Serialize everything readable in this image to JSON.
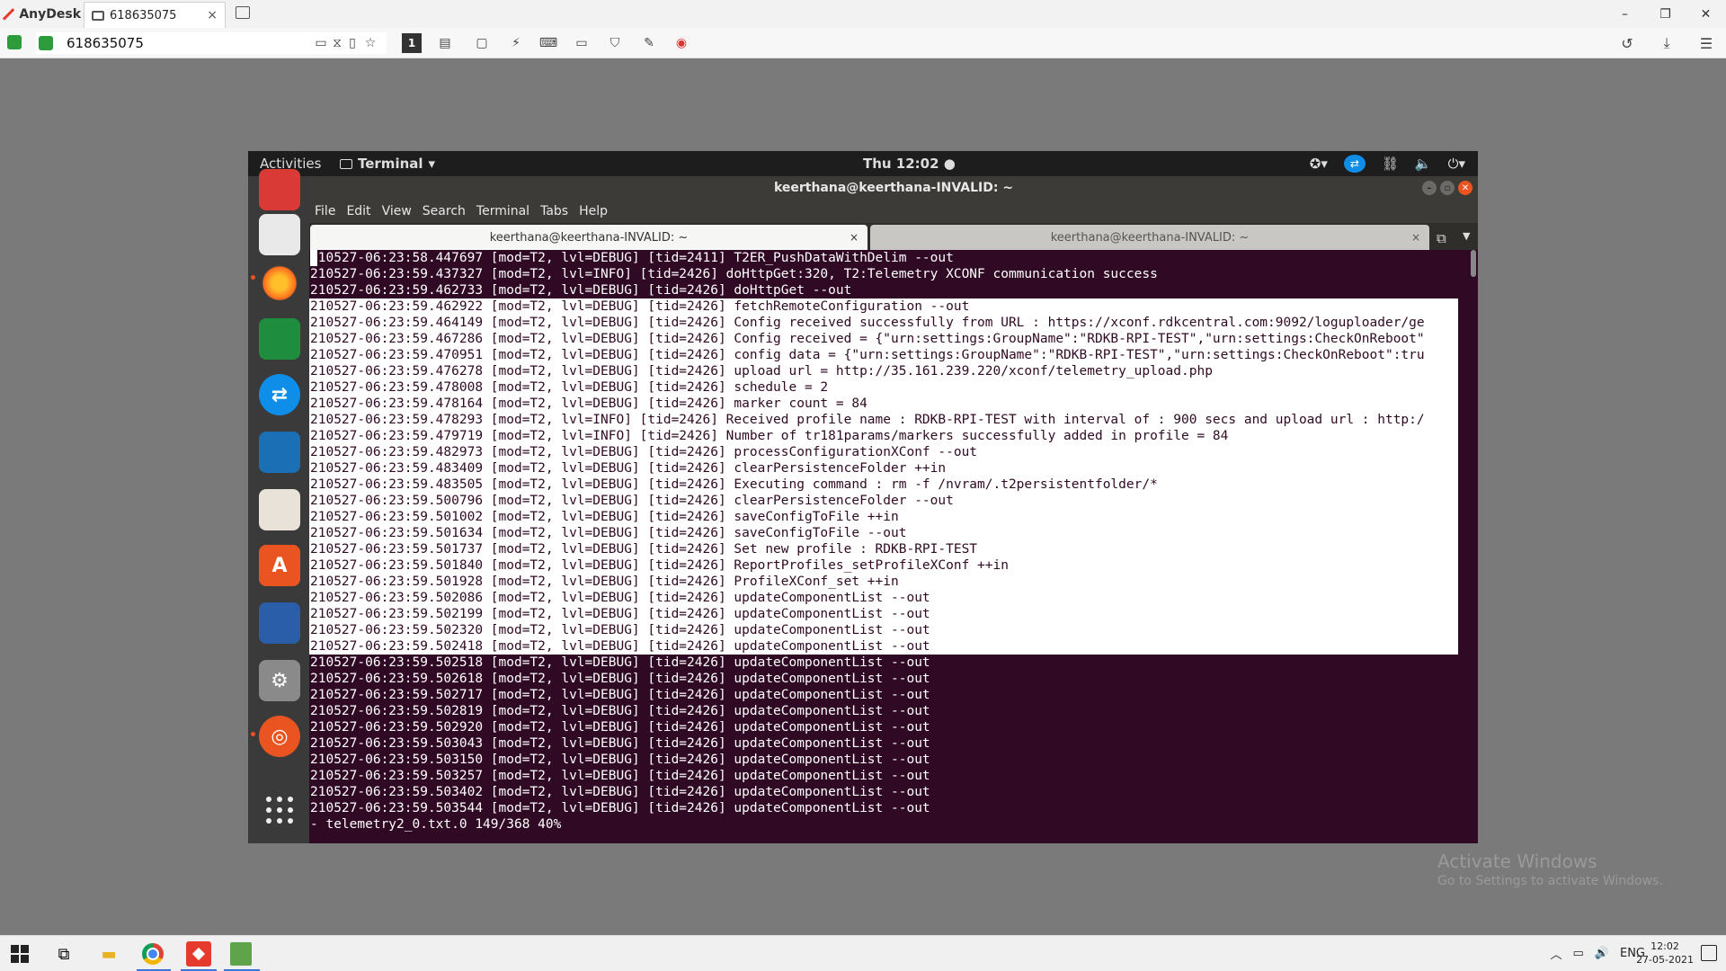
{
  "anydesk": {
    "app_name": "AnyDesk",
    "tab_label": "618635075",
    "tab_close": "×",
    "address_value": "618635075",
    "toolbar_number": "1",
    "win_min": "–",
    "win_restore": "❐",
    "win_close": "✕"
  },
  "ubuntu": {
    "activities": "Activities",
    "app_menu": "Terminal",
    "clock": "Thu 12:02 ●",
    "tv_badge": "⇄"
  },
  "terminal": {
    "window_title": "keerthana@keerthana-INVALID: ~",
    "menu": [
      "File",
      "Edit",
      "View",
      "Search",
      "Terminal",
      "Tabs",
      "Help"
    ],
    "tabs": [
      {
        "label": "keerthana@keerthana-INVALID: ~",
        "close": "×"
      },
      {
        "label": "keerthana@keerthana-INVALID: ~",
        "close": "×"
      }
    ],
    "lines": [
      "210527-06:23:58.447697 [mod=T2, lvl=DEBUG] [tid=2411] T2ER_PushDataWithDelim --out",
      "210527-06:23:59.437327 [mod=T2, lvl=INFO] [tid=2426] doHttpGet:320, T2:Telemetry XCONF communication success",
      "210527-06:23:59.462733 [mod=T2, lvl=DEBUG] [tid=2426] doHttpGet --out",
      "210527-06:23:59.462922 [mod=T2, lvl=DEBUG] [tid=2426] fetchRemoteConfiguration --out",
      "210527-06:23:59.464149 [mod=T2, lvl=DEBUG] [tid=2426] Config received successfully from URL : https://xconf.rdkcentral.com:9092/loguploader/ge",
      "210527-06:23:59.467286 [mod=T2, lvl=DEBUG] [tid=2426] Config received = {\"urn:settings:GroupName\":\"RDKB-RPI-TEST\",\"urn:settings:CheckOnReboot\"",
      "210527-06:23:59.470951 [mod=T2, lvl=DEBUG] [tid=2426] config data = {\"urn:settings:GroupName\":\"RDKB-RPI-TEST\",\"urn:settings:CheckOnReboot\":tru",
      "210527-06:23:59.476278 [mod=T2, lvl=DEBUG] [tid=2426] upload url = http://35.161.239.220/xconf/telemetry_upload.php",
      "210527-06:23:59.478008 [mod=T2, lvl=DEBUG] [tid=2426] schedule = 2",
      "210527-06:23:59.478164 [mod=T2, lvl=DEBUG] [tid=2426] marker count = 84",
      "210527-06:23:59.478293 [mod=T2, lvl=INFO] [tid=2426] Received profile name : RDKB-RPI-TEST with interval of : 900 secs and upload url : http:/",
      "210527-06:23:59.479719 [mod=T2, lvl=INFO] [tid=2426] Number of tr181params/markers successfully added in profile = 84",
      "210527-06:23:59.482973 [mod=T2, lvl=DEBUG] [tid=2426] processConfigurationXConf --out",
      "210527-06:23:59.483409 [mod=T2, lvl=DEBUG] [tid=2426] clearPersistenceFolder ++in",
      "210527-06:23:59.483505 [mod=T2, lvl=DEBUG] [tid=2426] Executing command : rm -f /nvram/.t2persistentfolder/*",
      "210527-06:23:59.500796 [mod=T2, lvl=DEBUG] [tid=2426] clearPersistenceFolder --out",
      "210527-06:23:59.501002 [mod=T2, lvl=DEBUG] [tid=2426] saveConfigToFile ++in",
      "210527-06:23:59.501634 [mod=T2, lvl=DEBUG] [tid=2426] saveConfigToFile --out",
      "210527-06:23:59.501737 [mod=T2, lvl=DEBUG] [tid=2426] Set new profile : RDKB-RPI-TEST",
      "210527-06:23:59.501840 [mod=T2, lvl=DEBUG] [tid=2426] ReportProfiles_setProfileXConf ++in",
      "210527-06:23:59.501928 [mod=T2, lvl=DEBUG] [tid=2426] ProfileXConf_set ++in",
      "210527-06:23:59.502086 [mod=T2, lvl=DEBUG] [tid=2426] updateComponentList --out",
      "210527-06:23:59.502199 [mod=T2, lvl=DEBUG] [tid=2426] updateComponentList --out",
      "210527-06:23:59.502320 [mod=T2, lvl=DEBUG] [tid=2426] updateComponentList --out",
      "210527-06:23:59.502418 [mod=T2, lvl=DEBUG] [tid=2426] updateComponentList --out",
      "210527-06:23:59.502518 [mod=T2, lvl=DEBUG] [tid=2426] updateComponentList --out",
      "210527-06:23:59.502618 [mod=T2, lvl=DEBUG] [tid=2426] updateComponentList --out",
      "210527-06:23:59.502717 [mod=T2, lvl=DEBUG] [tid=2426] updateComponentList --out",
      "210527-06:23:59.502819 [mod=T2, lvl=DEBUG] [tid=2426] updateComponentList --out",
      "210527-06:23:59.502920 [mod=T2, lvl=DEBUG] [tid=2426] updateComponentList --out",
      "210527-06:23:59.503043 [mod=T2, lvl=DEBUG] [tid=2426] updateComponentList --out",
      "210527-06:23:59.503150 [mod=T2, lvl=DEBUG] [tid=2426] updateComponentList --out",
      "210527-06:23:59.503257 [mod=T2, lvl=DEBUG] [tid=2426] updateComponentList --out",
      "210527-06:23:59.503402 [mod=T2, lvl=DEBUG] [tid=2426] updateComponentList --out",
      "210527-06:23:59.503544 [mod=T2, lvl=DEBUG] [tid=2426] updateComponentList --out",
      "- telemetry2_0.txt.0 149/368 40%"
    ],
    "selected_line_range": [
      3,
      24
    ]
  },
  "watermark": {
    "title": "Activate Windows",
    "subtitle": "Go to Settings to activate Windows."
  },
  "taskbar": {
    "lang": "ENG",
    "time": "12:02",
    "date": "27-05-2021"
  }
}
